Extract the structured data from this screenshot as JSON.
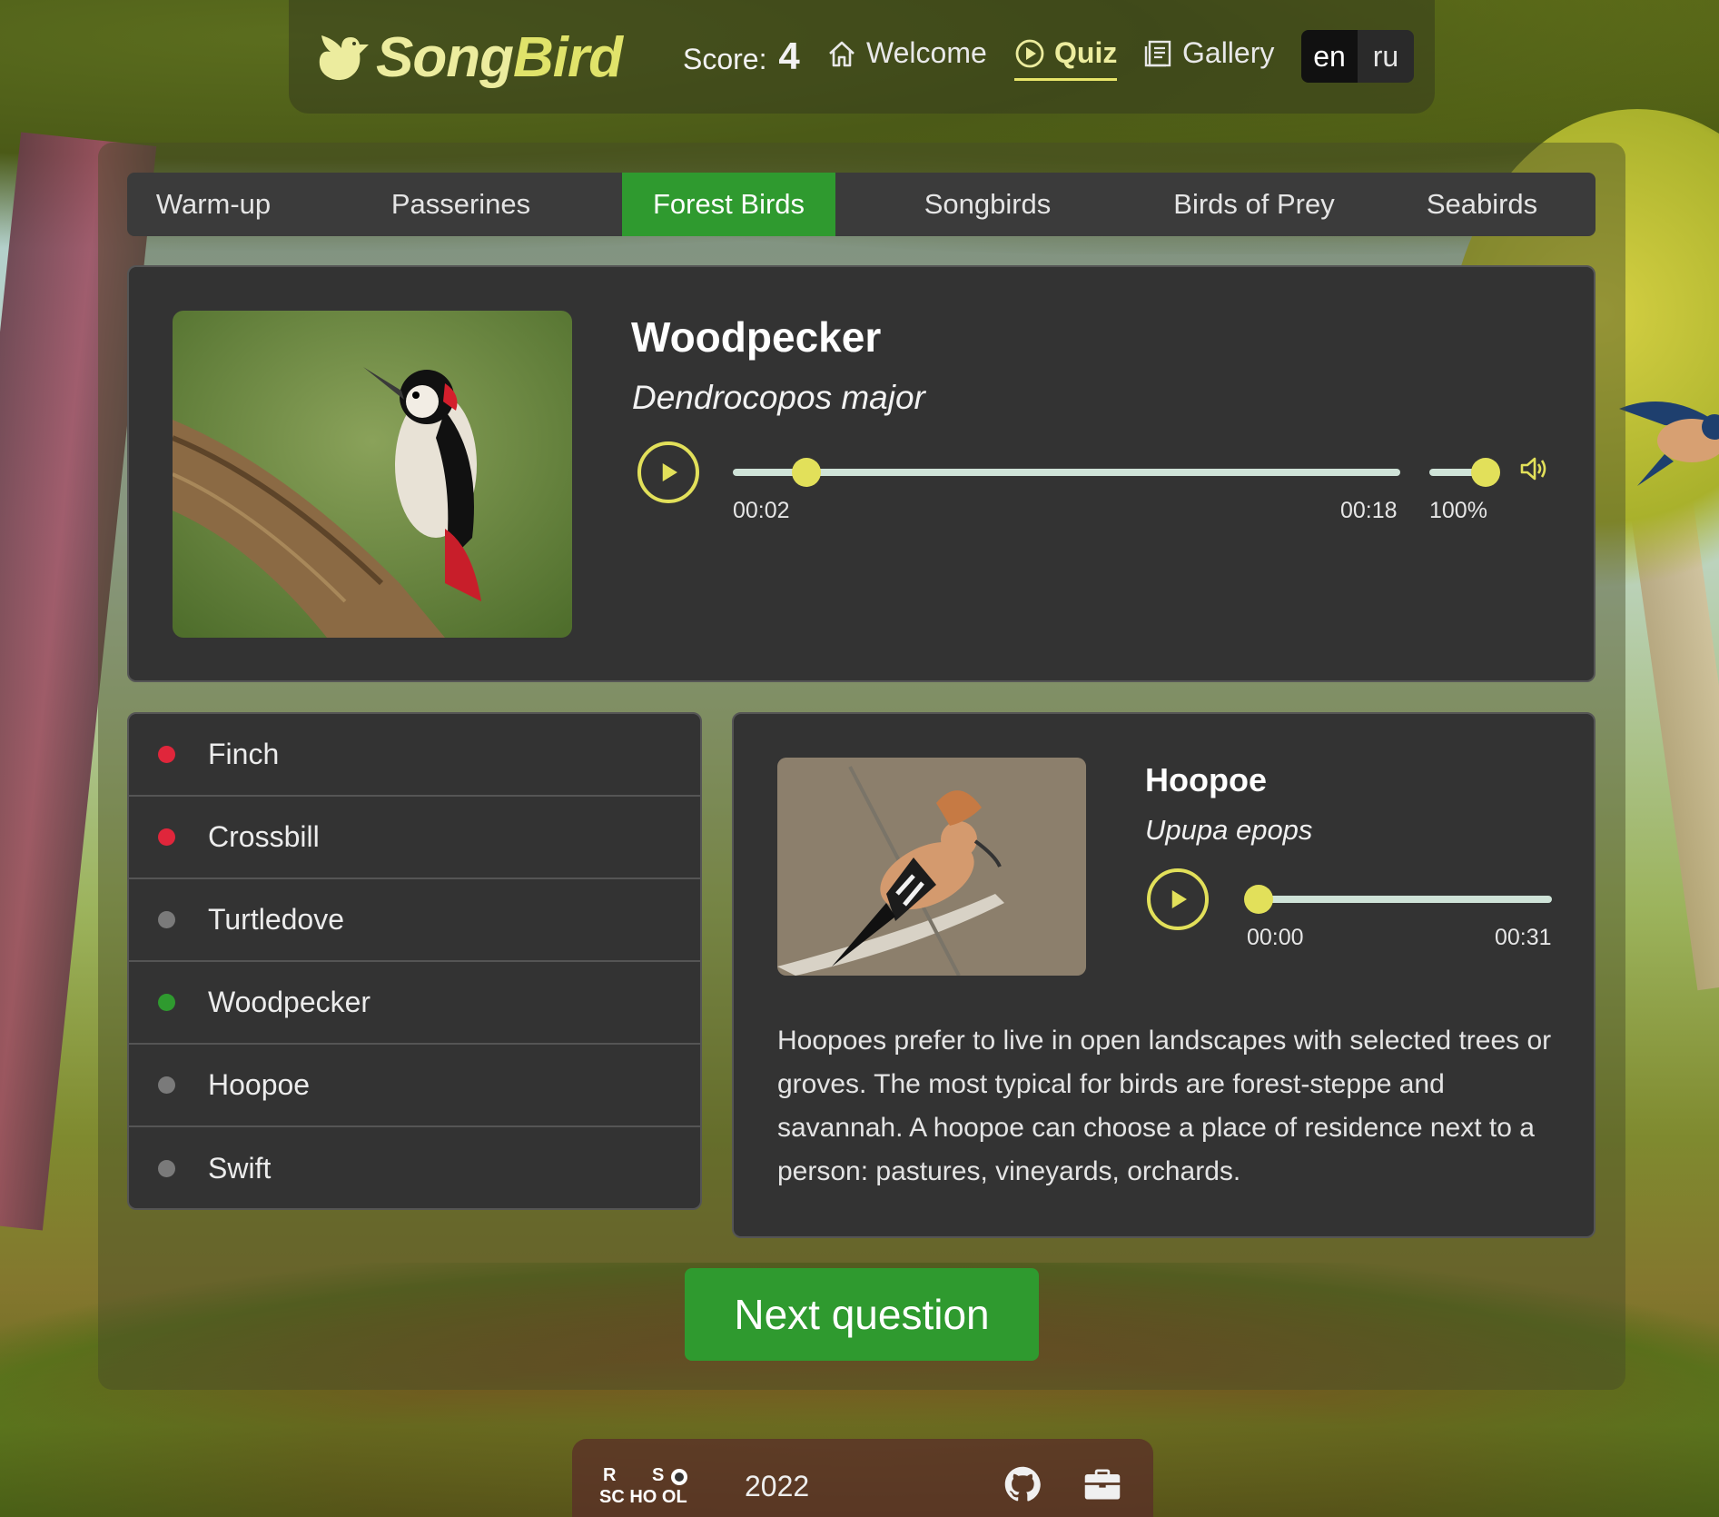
{
  "header": {
    "logo_text_a": "Song",
    "logo_text_b": "Bird",
    "score_label": "Score:",
    "score_value": "4",
    "nav": {
      "welcome": "Welcome",
      "quiz": "Quiz",
      "gallery": "Gallery"
    },
    "languages": [
      "en",
      "ru"
    ],
    "active_language": "en"
  },
  "tabs": [
    "Warm-up",
    "Passerines",
    "Forest Birds",
    "Songbirds",
    "Birds of Prey",
    "Seabirds"
  ],
  "active_tab": "Forest Birds",
  "question": {
    "name": "Woodpecker",
    "latin": "Dendrocopos major",
    "player": {
      "current_time": "00:02",
      "duration": "00:18",
      "volume": "100%",
      "progress": 0.11,
      "volume_level": 1.0
    }
  },
  "answers": [
    {
      "label": "Finch",
      "status": "wrong"
    },
    {
      "label": "Crossbill",
      "status": "wrong"
    },
    {
      "label": "Turtledove",
      "status": "neutral"
    },
    {
      "label": "Woodpecker",
      "status": "correct"
    },
    {
      "label": "Hoopoe",
      "status": "neutral"
    },
    {
      "label": "Swift",
      "status": "neutral"
    }
  ],
  "info": {
    "name": "Hoopoe",
    "latin": "Upupa epops",
    "player": {
      "current_time": "00:00",
      "duration": "00:31",
      "progress": 0.0
    },
    "description": "Hoopoes prefer to live in open landscapes with selected trees or groves. The most typical for birds are forest-steppe and savannah. A hoopoe can choose a place of residence next to a person: pastures, vineyards, orchards."
  },
  "next_button": "Next question",
  "footer": {
    "year": "2022",
    "school_logo": "RS SCHOOL"
  },
  "colors": {
    "accent": "#2f9a2f",
    "player": "#e2e05a",
    "wrong": "#e0263b",
    "panel": "#333333"
  },
  "icons": [
    "bird-logo-icon",
    "home-icon",
    "play-circle-icon",
    "gallery-icon",
    "play-icon",
    "volume-icon",
    "github-icon",
    "briefcase-icon"
  ]
}
